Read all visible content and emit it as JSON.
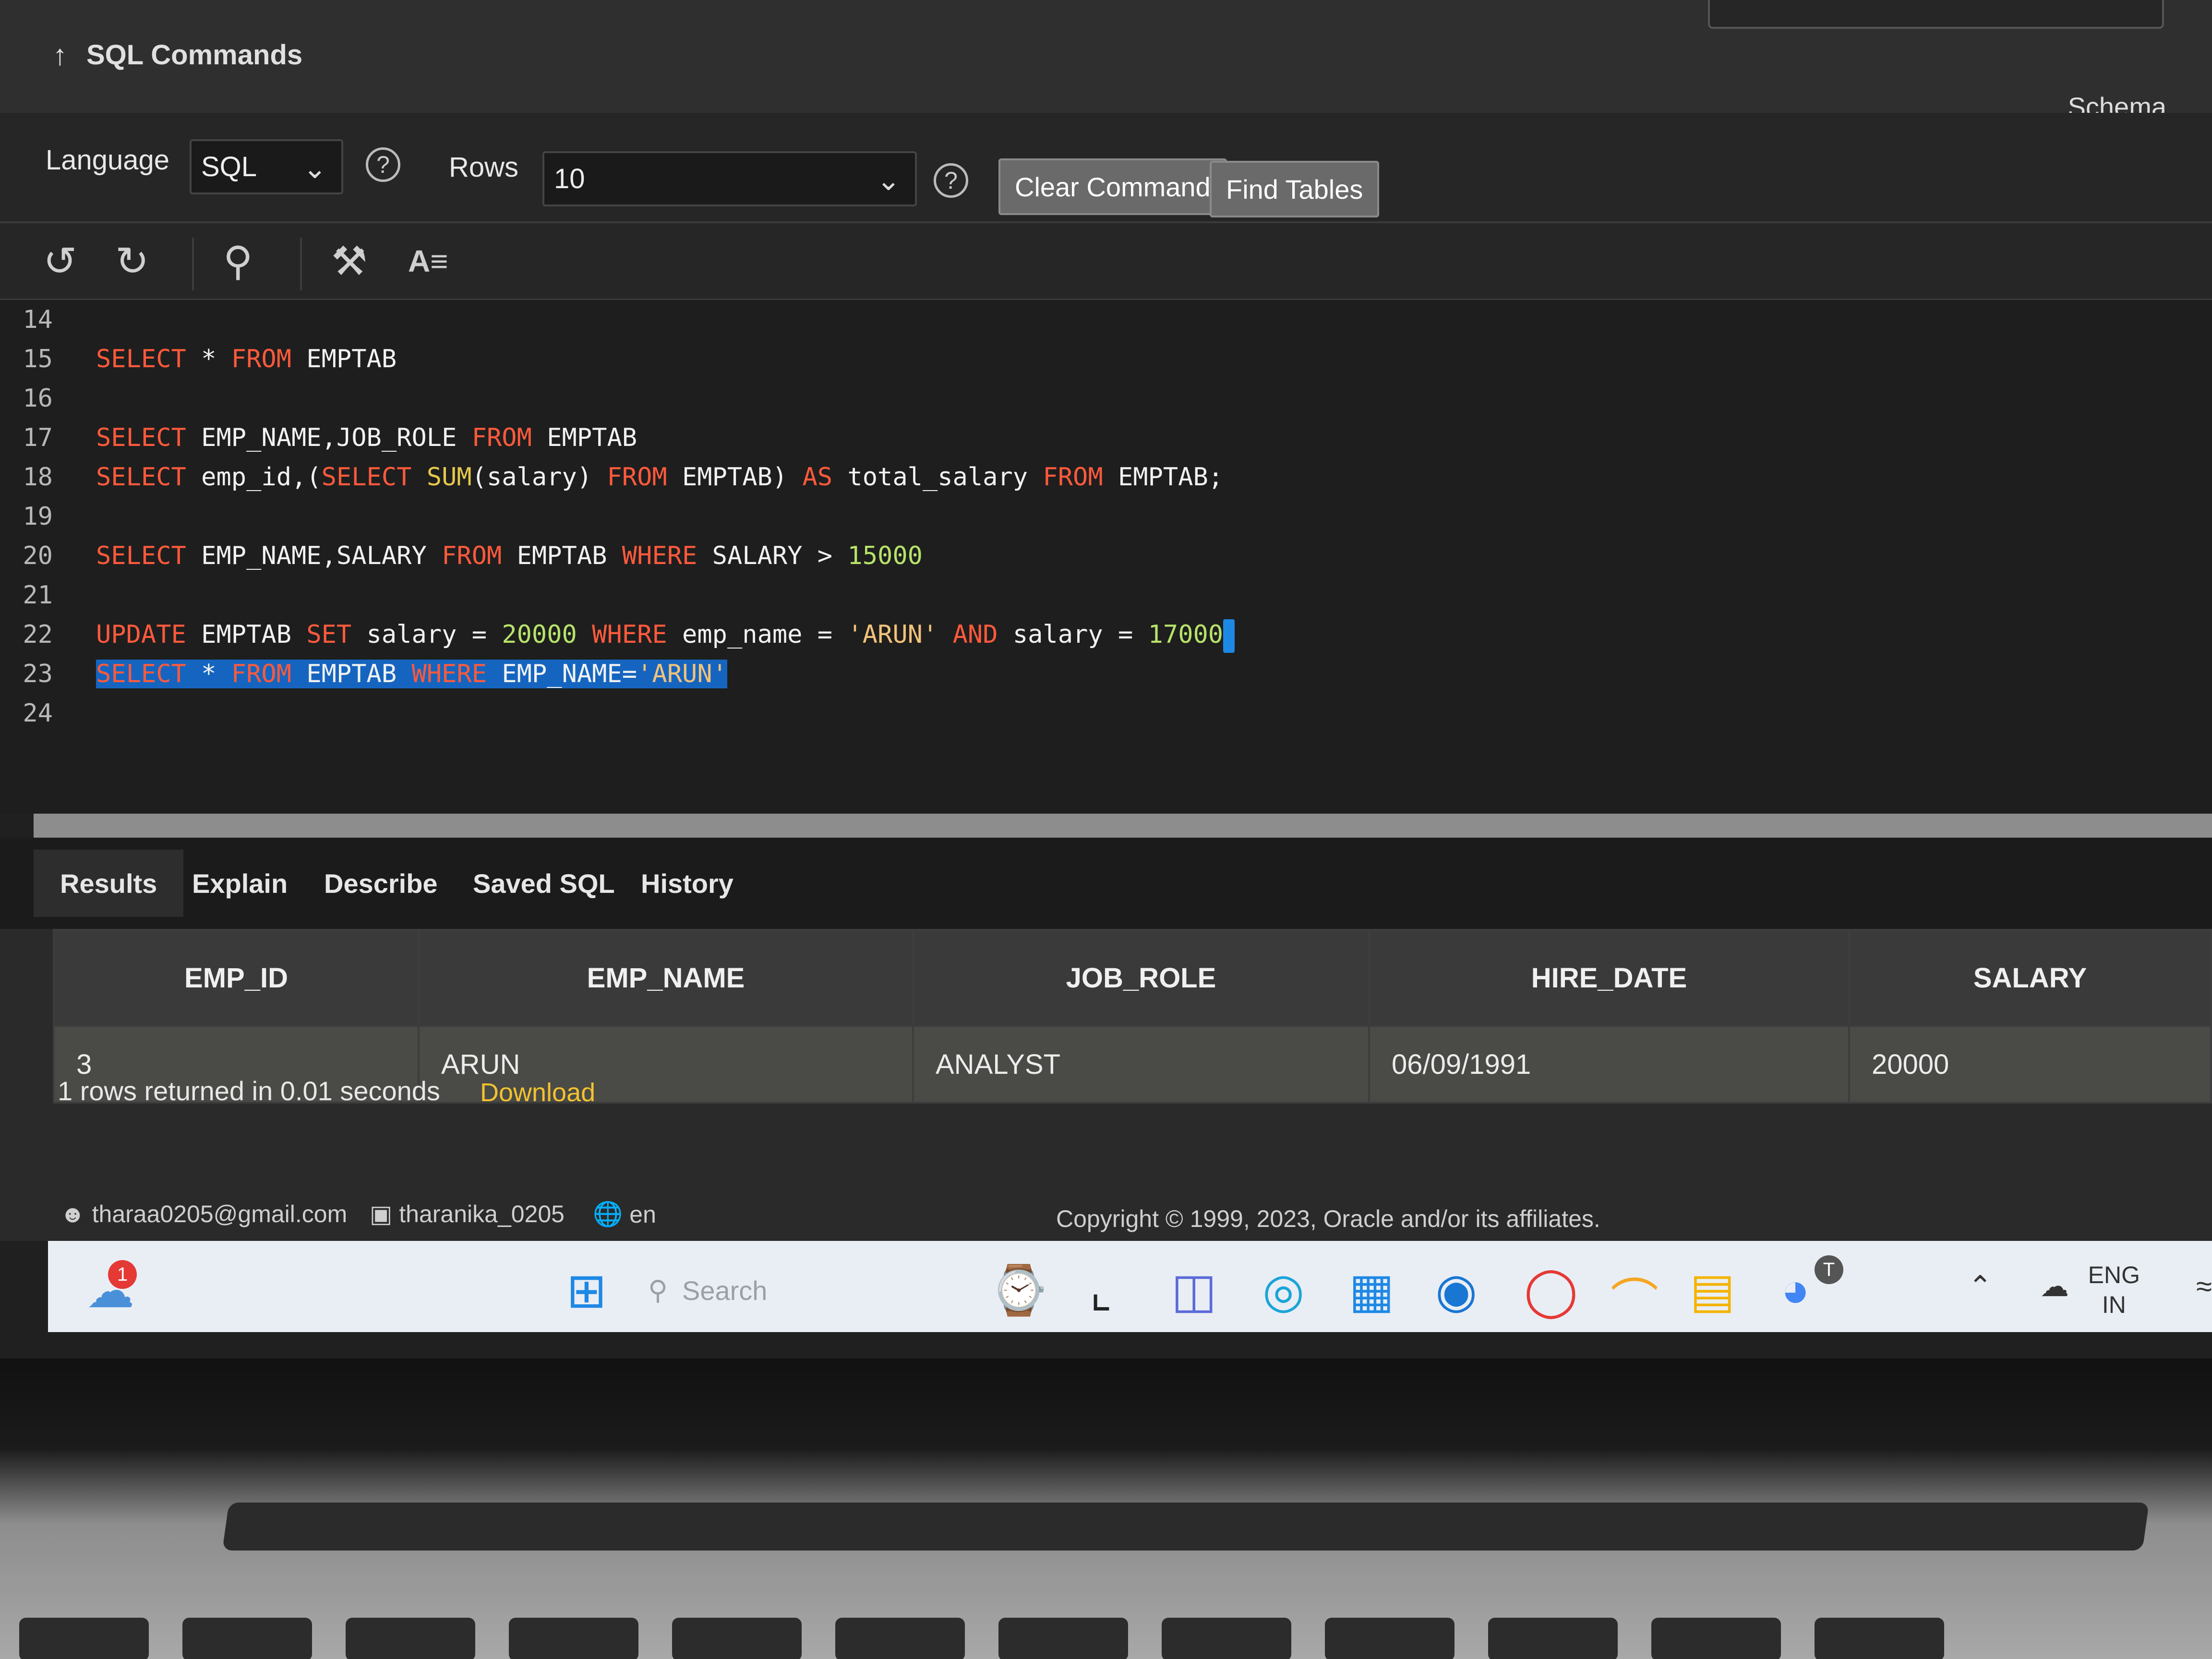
{
  "header": {
    "title": "SQL Commands",
    "schema_label": "Schema"
  },
  "options": {
    "language_label": "Language",
    "language_value": "SQL",
    "rows_label": "Rows",
    "rows_value": "10",
    "clear_command": "Clear Command",
    "find_tables": "Find Tables"
  },
  "toolbar": {
    "icons": [
      "undo-icon",
      "redo-icon",
      "search-icon",
      "hammer-icon",
      "format-text-icon"
    ],
    "format_label": "A≡"
  },
  "editor": {
    "lines": [
      {
        "n": "14",
        "code": ""
      },
      {
        "n": "15",
        "code": "SELECT * FROM EMPTAB"
      },
      {
        "n": "16",
        "code": ""
      },
      {
        "n": "17",
        "code": "SELECT EMP_NAME,JOB_ROLE FROM EMPTAB"
      },
      {
        "n": "18",
        "code": "SELECT emp_id,(SELECT SUM(salary) FROM EMPTAB) AS total_salary FROM EMPTAB;"
      },
      {
        "n": "19",
        "code": ""
      },
      {
        "n": "20",
        "code": "SELECT EMP_NAME,SALARY FROM EMPTAB WHERE SALARY > 15000"
      },
      {
        "n": "21",
        "code": ""
      },
      {
        "n": "22",
        "code": "UPDATE EMPTAB SET salary = 20000 WHERE emp_name = 'ARUN' AND salary = 17000"
      },
      {
        "n": "23",
        "code": "SELECT * FROM EMPTAB WHERE EMP_NAME='ARUN'"
      },
      {
        "n": "24",
        "code": ""
      }
    ]
  },
  "tabs": [
    "Results",
    "Explain",
    "Describe",
    "Saved SQL",
    "History"
  ],
  "results": {
    "columns": [
      "EMP_ID",
      "EMP_NAME",
      "JOB_ROLE",
      "HIRE_DATE",
      "SALARY"
    ],
    "rows": [
      [
        "3",
        "ARUN",
        "ANALYST",
        "06/09/1991",
        "20000"
      ]
    ],
    "summary": "1 rows returned in 0.01 seconds",
    "download": "Download"
  },
  "footer": {
    "user": "tharaa0205@gmail.com",
    "workspace": "tharanika_0205",
    "language": "en",
    "copyright": "Copyright © 1999, 2023, Oracle and/or its affiliates."
  },
  "taskbar": {
    "search_placeholder": "Search",
    "lang_line1": "ENG",
    "lang_line2": "IN",
    "notification_count": "1",
    "chrome_badge": "T"
  },
  "colors": {
    "keyword": "#ff5a3c",
    "selection": "#1565c0",
    "download_link": "#f2c230"
  }
}
